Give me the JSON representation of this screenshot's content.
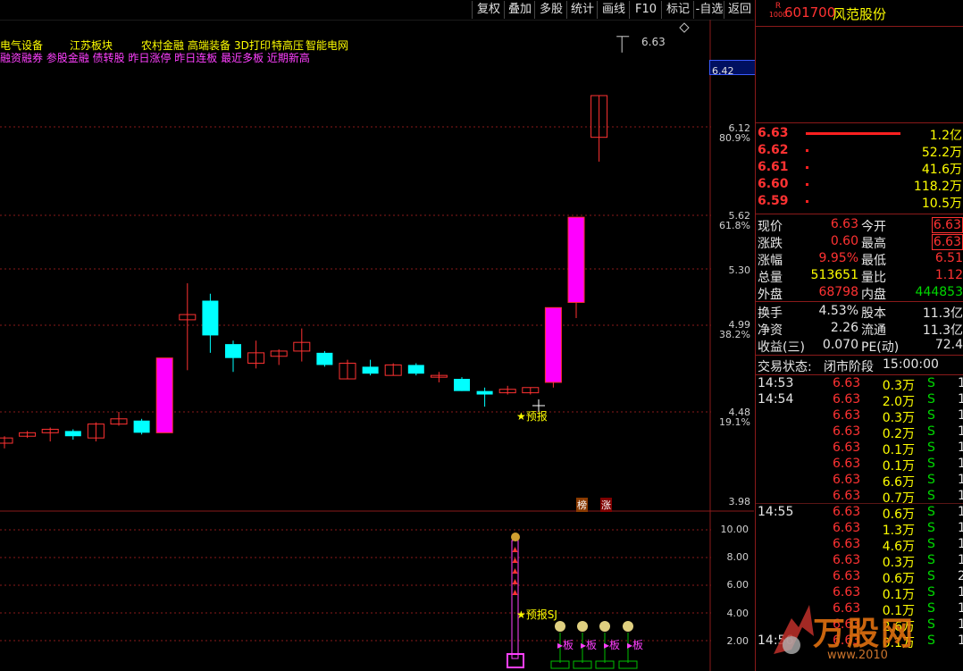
{
  "toolbar": {
    "buttons": [
      "复权",
      "叠加",
      "多股",
      "统计",
      "画线",
      "F10",
      "标记",
      "-自选",
      "返回"
    ]
  },
  "stock": {
    "badge_top": "R",
    "badge_bottom": "1000",
    "code": "601700",
    "name": "风范股份"
  },
  "concepts": {
    "line1": [
      "电气设备",
      "江苏板块",
      "农村金融",
      "高端装备",
      "3D打印",
      "特高压",
      "智能电网"
    ],
    "line2": "融资融券 参股金融 债转股 昨日涨停 昨日连板 最近多板 近期新高"
  },
  "price_axis": [
    {
      "price": "6.63",
      "pct": ""
    },
    {
      "price": "6.42",
      "pct": ""
    },
    {
      "price": "6.12",
      "pct": "80.9%"
    },
    {
      "price": "5.62",
      "pct": "61.8%"
    },
    {
      "price": "5.30",
      "pct": ""
    },
    {
      "price": "4.99",
      "pct": "38.2%"
    },
    {
      "price": "4.48",
      "pct": "19.1%"
    },
    {
      "price": "3.98",
      "pct": ""
    }
  ],
  "high_marker": "6.63",
  "current_price_box": "6.42",
  "annotations": {
    "forecast": "★预报",
    "bang": "榜",
    "zhang": "涨",
    "forecast_sj": "★预报SJ",
    "ban": "板"
  },
  "indicator_axis": [
    "10.00",
    "8.00",
    "6.00",
    "4.00",
    "2.00"
  ],
  "order_book": [
    {
      "price": "6.63",
      "vol": "1.2亿",
      "bar": 1.0
    },
    {
      "price": "6.62",
      "vol": "52.2万",
      "bar": 0.02
    },
    {
      "price": "6.61",
      "vol": "41.6万",
      "bar": 0.02
    },
    {
      "price": "6.60",
      "vol": "118.2万",
      "bar": 0.02
    },
    {
      "price": "6.59",
      "vol": "10.5万",
      "bar": 0.02
    }
  ],
  "quote": [
    {
      "l": "现价",
      "v": "6.63",
      "l2": "今开",
      "v2": "6.63"
    },
    {
      "l": "涨跌",
      "v": "0.60",
      "l2": "最高",
      "v2": "6.63"
    },
    {
      "l": "涨幅",
      "v": "9.95%",
      "l2": "最低",
      "v2": "6.51"
    },
    {
      "l": "总量",
      "v": "513651",
      "l2": "量比",
      "v2": "1.12"
    },
    {
      "l": "外盘",
      "v": "68798",
      "l2": "内盘",
      "v2": "444853"
    }
  ],
  "fundamentals": [
    {
      "l": "换手",
      "v": "4.53%",
      "l2": "股本",
      "v2": "11.3亿"
    },
    {
      "l": "净资",
      "v": "2.26",
      "l2": "流通",
      "v2": "11.3亿"
    },
    {
      "l": "收益(三)",
      "v": "0.070",
      "l2": "PE(动)",
      "v2": "72.4"
    }
  ],
  "trade_status": {
    "label": "交易状态:",
    "value": "闭市阶段",
    "time": "15:00:00"
  },
  "ticks": [
    {
      "time": "14:53",
      "price": "6.63",
      "vol": "0.3万",
      "side": "S",
      "n": "1"
    },
    {
      "time": "14:54",
      "price": "6.63",
      "vol": "2.0万",
      "side": "S",
      "n": "1"
    },
    {
      "time": "",
      "price": "6.63",
      "vol": "0.3万",
      "side": "S",
      "n": "1"
    },
    {
      "time": "",
      "price": "6.63",
      "vol": "0.2万",
      "side": "S",
      "n": "1"
    },
    {
      "time": "",
      "price": "6.63",
      "vol": "0.1万",
      "side": "S",
      "n": "1"
    },
    {
      "time": "",
      "price": "6.63",
      "vol": "0.1万",
      "side": "S",
      "n": "1"
    },
    {
      "time": "",
      "price": "6.63",
      "vol": "6.6万",
      "side": "S",
      "n": "1"
    },
    {
      "time": "",
      "price": "6.63",
      "vol": "0.7万",
      "side": "S",
      "n": "1"
    },
    {
      "time": "14:55",
      "price": "6.63",
      "vol": "0.6万",
      "side": "S",
      "n": "1"
    },
    {
      "time": "",
      "price": "6.63",
      "vol": "1.3万",
      "side": "S",
      "n": "1"
    },
    {
      "time": "",
      "price": "6.63",
      "vol": "4.6万",
      "side": "S",
      "n": "1"
    },
    {
      "time": "",
      "price": "6.63",
      "vol": "0.3万",
      "side": "S",
      "n": "1"
    },
    {
      "time": "",
      "price": "6.63",
      "vol": "0.6万",
      "side": "S",
      "n": "2"
    },
    {
      "time": "",
      "price": "6.63",
      "vol": "0.1万",
      "side": "S",
      "n": "1"
    },
    {
      "time": "",
      "price": "6.63",
      "vol": "0.1万",
      "side": "S",
      "n": "1"
    },
    {
      "time": "",
      "price": "6.63",
      "vol": "2.6万",
      "side": "S",
      "n": "1"
    },
    {
      "time": "14:56",
      "price": "6.63",
      "vol": "0.1万",
      "side": "S",
      "n": "1"
    }
  ],
  "watermark": {
    "brand": "万股网",
    "url": "www.2010"
  },
  "candles": [
    {
      "o": 4.3,
      "c": 4.33,
      "h": 4.34,
      "l": 4.27
    },
    {
      "o": 4.34,
      "c": 4.36,
      "h": 4.37,
      "l": 4.33
    },
    {
      "o": 4.36,
      "c": 4.38,
      "h": 4.39,
      "l": 4.31
    },
    {
      "o": 4.37,
      "c": 4.34,
      "h": 4.38,
      "l": 4.32
    },
    {
      "o": 4.33,
      "c": 4.41,
      "h": 4.42,
      "l": 4.31
    },
    {
      "o": 4.41,
      "c": 4.44,
      "h": 4.48,
      "l": 4.4
    },
    {
      "o": 4.43,
      "c": 4.36,
      "h": 4.44,
      "l": 4.35
    },
    {
      "o": 4.36,
      "c": 4.79,
      "h": 4.79,
      "l": 4.36
    },
    {
      "o": 5.01,
      "c": 5.04,
      "h": 5.22,
      "l": 4.72
    },
    {
      "o": 5.12,
      "c": 4.92,
      "h": 5.16,
      "l": 4.82
    },
    {
      "o": 4.87,
      "c": 4.79,
      "h": 4.89,
      "l": 4.71
    },
    {
      "o": 4.76,
      "c": 4.82,
      "h": 4.89,
      "l": 4.73
    },
    {
      "o": 4.8,
      "c": 4.83,
      "h": 4.84,
      "l": 4.75
    },
    {
      "o": 4.83,
      "c": 4.88,
      "h": 4.96,
      "l": 4.77
    },
    {
      "o": 4.82,
      "c": 4.75,
      "h": 4.83,
      "l": 4.74
    },
    {
      "o": 4.67,
      "c": 4.76,
      "h": 4.78,
      "l": 4.67
    },
    {
      "o": 4.74,
      "c": 4.7,
      "h": 4.78,
      "l": 4.69
    },
    {
      "o": 4.69,
      "c": 4.75,
      "h": 4.76,
      "l": 4.69
    },
    {
      "o": 4.75,
      "c": 4.7,
      "h": 4.76,
      "l": 4.69
    },
    {
      "o": 4.68,
      "c": 4.69,
      "h": 4.71,
      "l": 4.65
    },
    {
      "o": 4.67,
      "c": 4.6,
      "h": 4.68,
      "l": 4.6
    },
    {
      "o": 4.6,
      "c": 4.58,
      "h": 4.62,
      "l": 4.51
    },
    {
      "o": 4.59,
      "c": 4.61,
      "h": 4.63,
      "l": 4.58
    },
    {
      "o": 4.59,
      "c": 4.62,
      "h": 4.62,
      "l": 4.58
    },
    {
      "o": 4.65,
      "c": 5.08,
      "h": 5.08,
      "l": 4.62
    },
    {
      "o": 5.11,
      "c": 5.6,
      "h": 5.6,
      "l": 5.02
    },
    {
      "o": 6.06,
      "c": 6.3,
      "h": 6.3,
      "l": 5.92
    }
  ],
  "colors": {
    "up": "#ff3232",
    "down": "#00ffff",
    "limit": "#ff00ff",
    "grid": "#8a1a1a",
    "axis": "#8a1a1a"
  }
}
